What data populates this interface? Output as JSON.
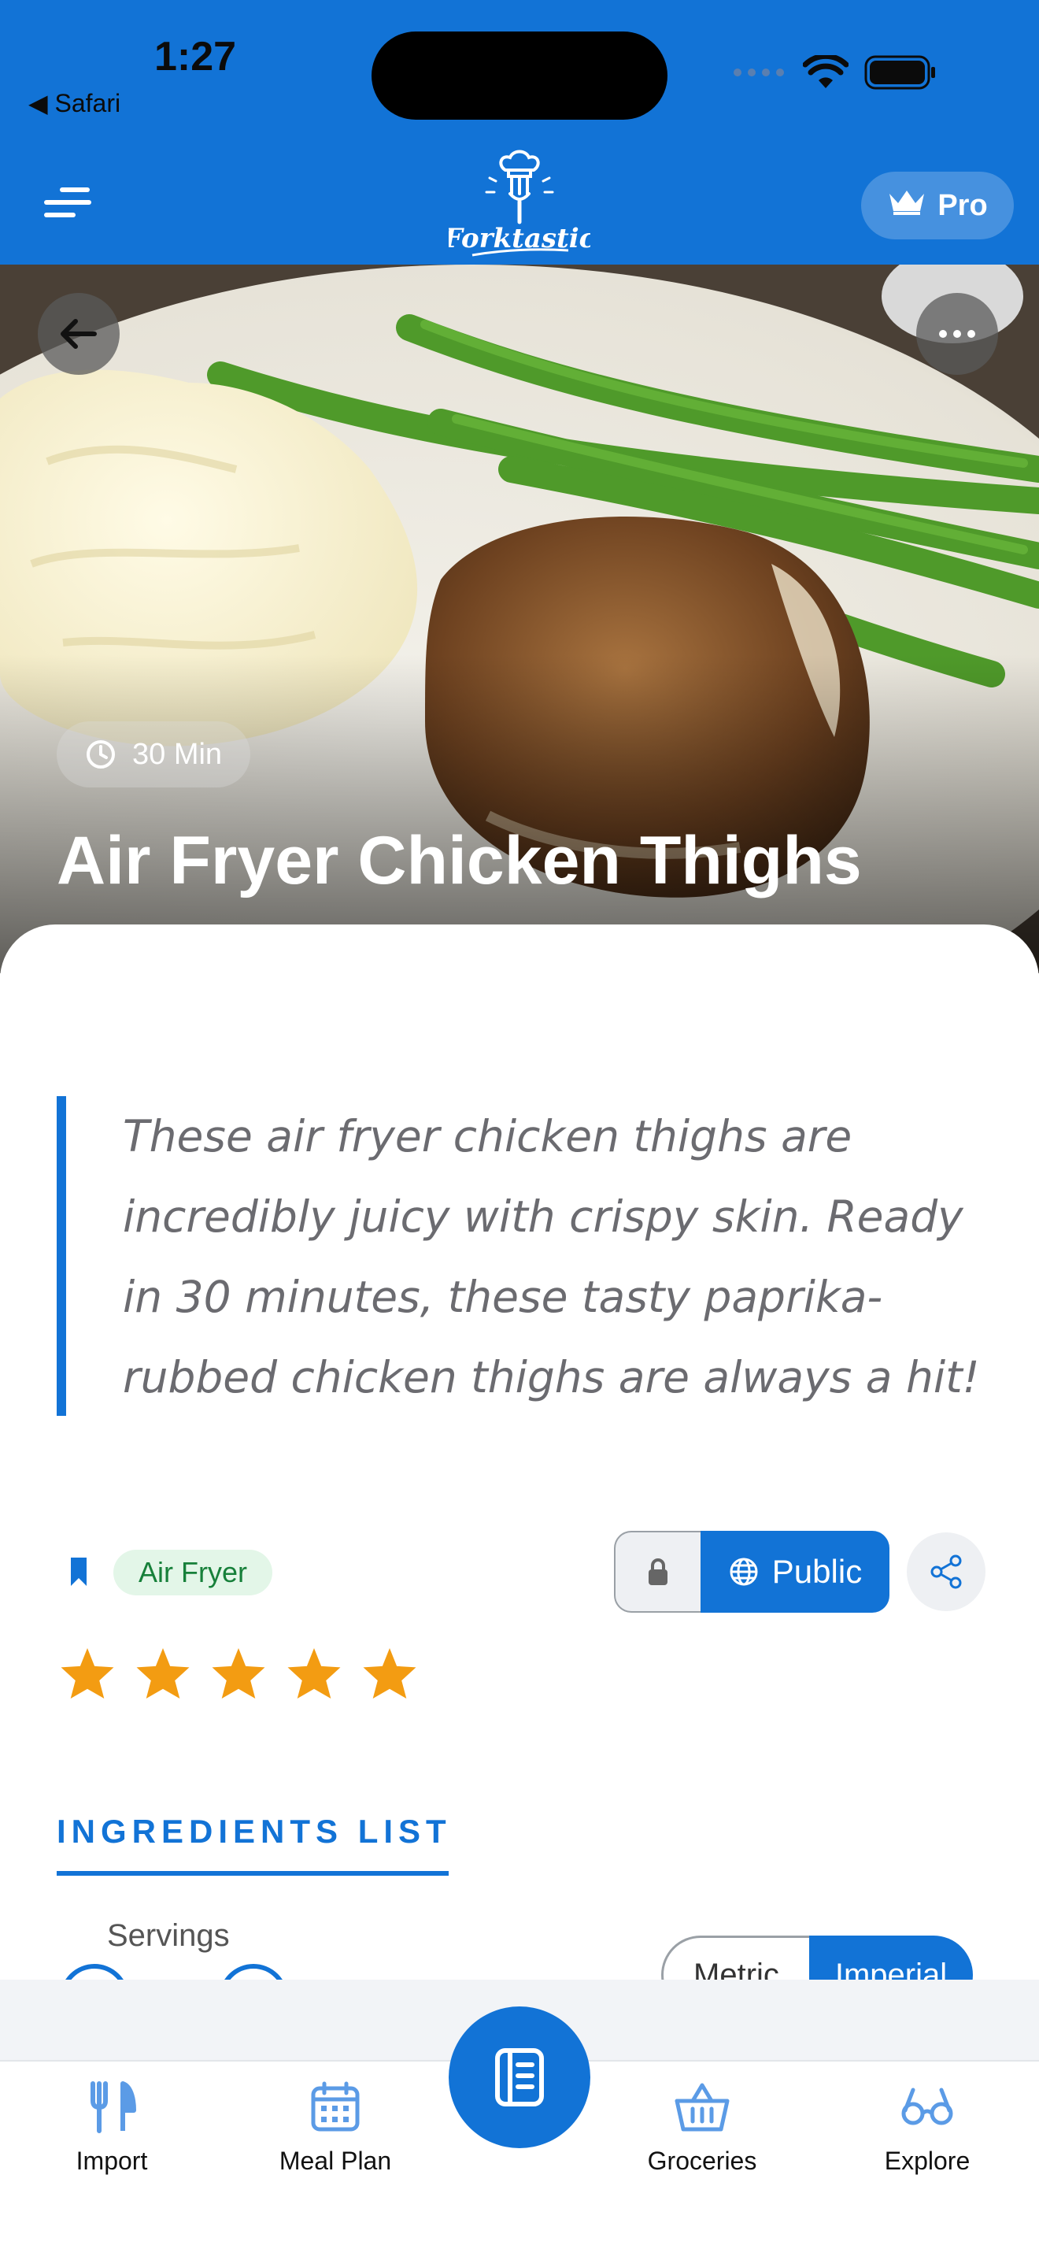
{
  "status_bar": {
    "time": "1:27",
    "back_app": "◀ Safari"
  },
  "header": {
    "pro_label": "Pro",
    "logo_text": "Forktastic"
  },
  "hero": {
    "time_label": "30 Min",
    "title": "Air Fryer Chicken Thighs"
  },
  "description": "These air fryer chicken thighs are incredibly juicy with crispy skin. Ready in 30 minutes, these tasty paprika-rubbed chicken thighs are always a hit!",
  "meta": {
    "tag": "Air Fryer",
    "visibility": "Public",
    "rating": 5,
    "rating_max": 5
  },
  "ingredients": {
    "title": "INGREDIENTS LIST",
    "servings_label": "Servings",
    "unit_metric": "Metric",
    "unit_imperial": "Imperial"
  },
  "nav": {
    "items": [
      {
        "label": "Import",
        "icon": "fork-knife-icon"
      },
      {
        "label": "Meal Plan",
        "icon": "calendar-icon"
      },
      {
        "label": "",
        "icon": "recipe-book-icon"
      },
      {
        "label": "Groceries",
        "icon": "basket-icon"
      },
      {
        "label": "Explore",
        "icon": "glasses-icon"
      }
    ]
  },
  "colors": {
    "brand": "#1273d6",
    "star": "#f39c12",
    "tag_bg": "#e3f6e8",
    "tag_text": "#17803a"
  }
}
